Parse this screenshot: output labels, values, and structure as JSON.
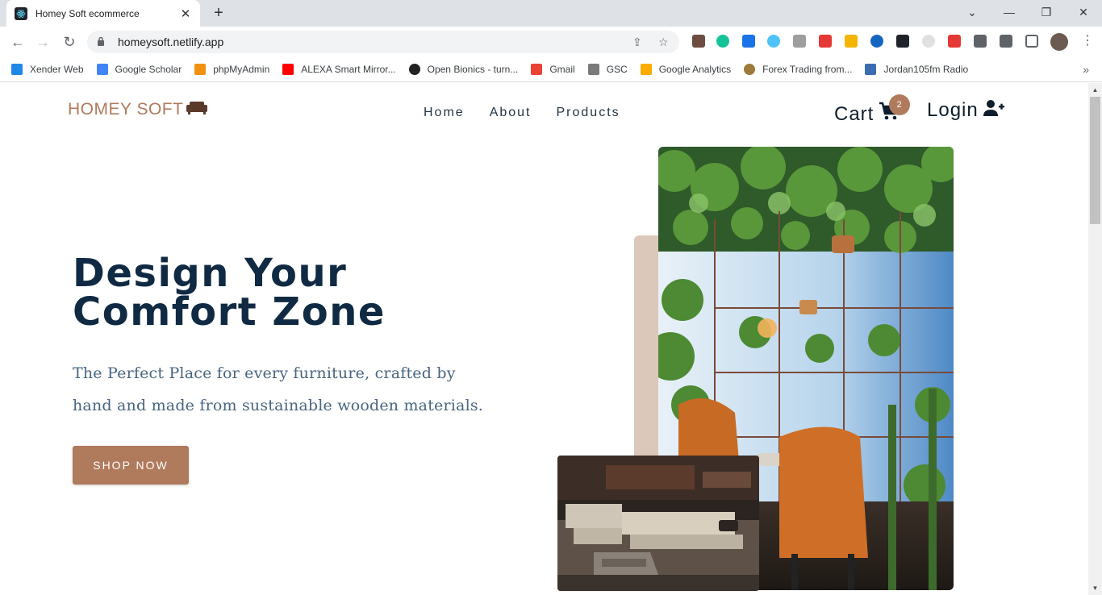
{
  "browser": {
    "tab_title": "Homey Soft ecommerce",
    "url": "homeysoft.netlify.app",
    "bookmarks": [
      {
        "label": "Xender Web",
        "color": "#1e88e5"
      },
      {
        "label": "Google Scholar",
        "color": "#4285f4"
      },
      {
        "label": "phpMyAdmin",
        "color": "#f29111"
      },
      {
        "label": "ALEXA Smart Mirror...",
        "color": "#ff0000"
      },
      {
        "label": "Open Bionics - turn...",
        "color": "#222222"
      },
      {
        "label": "Gmail",
        "color": "#ea4335"
      },
      {
        "label": "GSC",
        "color": "#7a7a7a"
      },
      {
        "label": "Google Analytics",
        "color": "#f9ab00"
      },
      {
        "label": "Forex Trading from...",
        "color": "#9e7b3a"
      },
      {
        "label": "Jordan105fm Radio",
        "color": "#3b6db2"
      }
    ]
  },
  "site": {
    "logo": "HOMEY SOFT",
    "nav": [
      "Home",
      "About",
      "Products"
    ],
    "cart_label": "Cart",
    "cart_count": "2",
    "login_label": "Login",
    "hero": {
      "title_line1": "Design Your",
      "title_line2": "Comfort Zone",
      "text": "The Perfect Place for every furniture, crafted by hand and made from sustainable wooden materials.",
      "cta": "SHOP NOW"
    },
    "colors": {
      "brand": "#b07a5c",
      "heading": "#102a43",
      "body": "#486581",
      "accent_block": "#dcc8bb"
    }
  }
}
